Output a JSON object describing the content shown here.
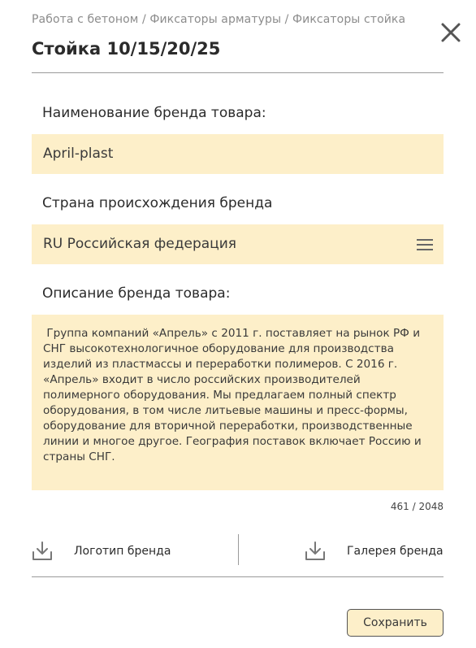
{
  "header": {
    "breadcrumb": "Работа с бетоном / Фиксаторы арматуры / Фиксаторы стойка",
    "title": "Стойка 10/15/20/25"
  },
  "form": {
    "brand_name_label": "Наименование бренда товара:",
    "brand_name_value": "April-plast",
    "country_label": "Страна происхождения бренда",
    "country_value": "RU Российская федерация",
    "description_label": "Описание бренда товара:",
    "description_value": " Группа компаний «Апрель» с 2011 г. поставляет на рынок РФ и СНГ высокотехнологичное оборудование для производства изделий из пластмассы и переработки полимеров. С 2016 г. «Апрель» входит в число российских производителей полимерного оборудования. Мы предлагаем полный спектр оборудования, в том числе литьевые машины и пресс-формы, оборудование для вторичной переработки, производственные линии и многое другое. География поставок включает Россию и страны СНГ.",
    "char_counter": "461 / 2048"
  },
  "uploads": {
    "logo_label": "Логотип бренда",
    "gallery_label": "Галерея бренда"
  },
  "actions": {
    "save_label": "Сохранить"
  },
  "icons": {
    "close": "close-icon",
    "select_menu": "menu-icon",
    "download": "download-icon"
  },
  "colors": {
    "field_background": "#fdefc9",
    "text": "#2b2b2b",
    "muted_text": "#8c8c8c",
    "divider": "#9a9a9a"
  }
}
